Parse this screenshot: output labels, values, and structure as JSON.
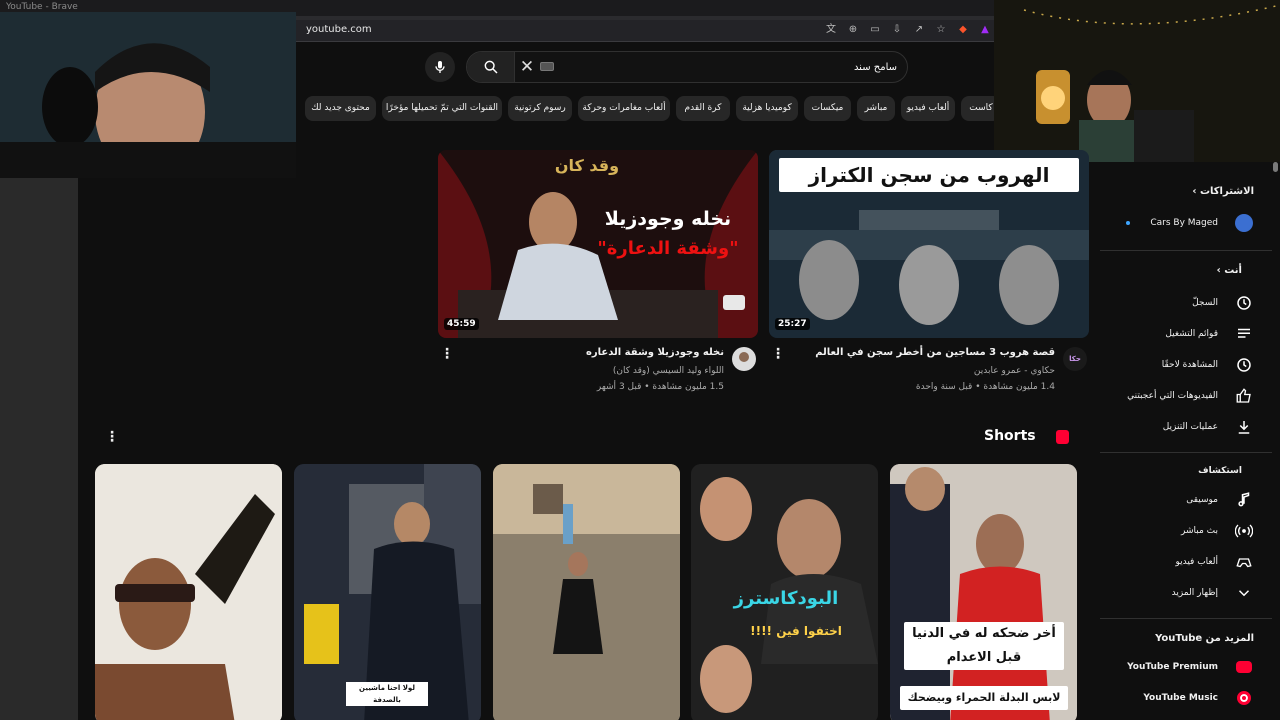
{
  "window": {
    "title": "YouTube - Brave"
  },
  "browser": {
    "url": "youtube.com"
  },
  "search": {
    "value": "سامح سند"
  },
  "chips": [
    "كاست",
    "ألعاب فيديو",
    "مباشر",
    "ميكسات",
    "كوميديا هزلية",
    "كرة القدم",
    "ألعاب مغامرات وحركة",
    "رسوم كرتونية",
    "القنوات التي تمّ تحميلها مؤخرًا",
    "محتوى جديد لك"
  ],
  "videos": [
    {
      "title": "قصة هروب 3 مساجين من أخطر سجن في العالم",
      "channel": "حكاوي - عمرو عابدين",
      "meta": "1.4 مليون مشاهدة • قبل سنة واحدة",
      "duration": "25:27",
      "thumb_text": "الهروب من سجن الكتراز"
    },
    {
      "title": "نخله وجودزيلا وشقة الدعاره",
      "channel": "اللواء وليد السيسي (وقد كان)",
      "meta": "1.5 مليون مشاهدة • قبل 3 أشهر",
      "duration": "45:59",
      "thumb_text_1": "وقد كان",
      "thumb_text_2": "نخله وجودزيلا",
      "thumb_text_3": "\"وشقة الدعارة\""
    }
  ],
  "shorts": {
    "title": "Shorts",
    "items": [
      {
        "overlay": "أخر ضحكه له في الدنيا قبل الاعدام",
        "caption": "لابس البدلة الحمراء وبيضحك"
      },
      {
        "overlay": "البودكاسترز",
        "caption": "اختفوا فين !!!!"
      },
      {
        "overlay": "",
        "caption": ""
      },
      {
        "overlay": "",
        "caption": "لولا احنا ماشيين بالصدفة"
      },
      {
        "overlay": "",
        "caption": ""
      }
    ]
  },
  "sidebar": {
    "subscriptions_title": "الاشتراكات",
    "subscriptions": [
      "Cars By Maged"
    ],
    "you_title": "أنت",
    "you_items": [
      "السجلّ",
      "قوائم التشغيل",
      "المشاهدة لاحقًا",
      "الفيديوهات التي أعجبتني",
      "عمليات التنزيل"
    ],
    "explore_title": "استكشاف",
    "explore_items": [
      "موسيقى",
      "بث مباشر",
      "ألعاب فيديو",
      "إظهار المزيد"
    ],
    "more_title": "المزيد من YouTube",
    "more_items": [
      "YouTube Premium",
      "YouTube Music"
    ]
  },
  "colors": {
    "accent": "#ff0033",
    "bg": "#0f0f0f",
    "chip": "#272727"
  }
}
